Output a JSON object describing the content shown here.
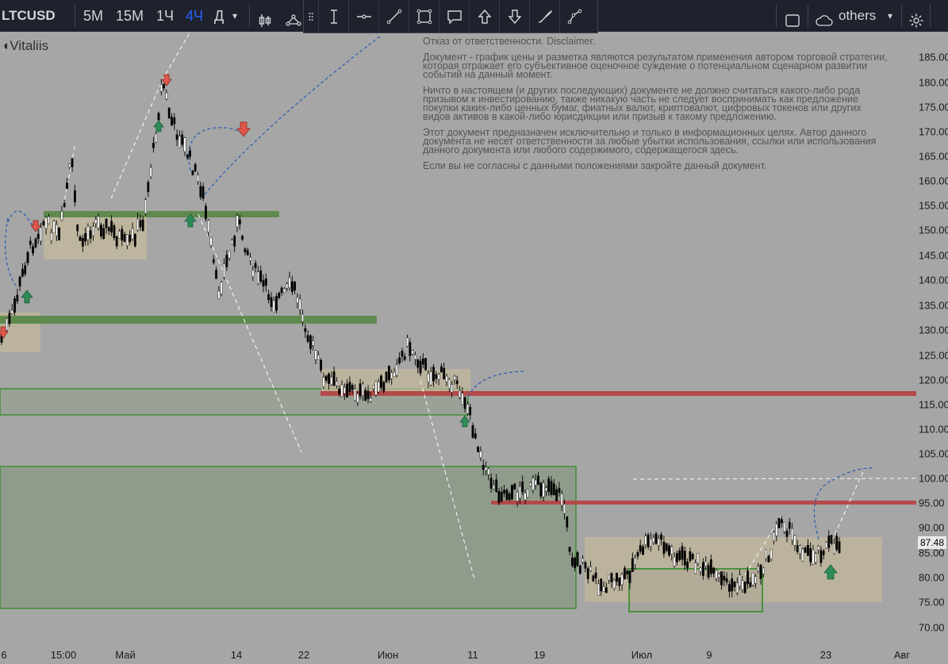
{
  "toolbar": {
    "symbol": "LTCUSD",
    "intervals": [
      "5М",
      "15М",
      "1Ч",
      "4Ч",
      "Д"
    ],
    "active_interval": "4Ч",
    "layout_name": "others"
  },
  "watermark": {
    "author": "Vitaliis"
  },
  "disclaimer": {
    "p1": "Отказ от ответственности. Disclaimer.",
    "p2": "Документ - график цены и разметка являются результатом применения автором торговой стратегии, которая отражает его субъективное оценочное суждение о потенциальном сценарном развитии событий на данный момент.",
    "p3": "Ничто в настоящем (и других последующих) документе не должно считаться какого-либо рода призывом к инвестированию, также никакую часть не следует воспринимать как предложение покупки каких-либо ценных бумаг, фиатных валют, криптовалют, цифровых токенов или других видов активов в какой-либо юрисдикции или призыв к такому предложению.",
    "p4": "Этот документ предназначен исключительно и только в информационных целях. Автор данного документа не несет ответственности за любые убытки использования, ссылки или использования данного документа или любого содержимого, содержащегося здесь.",
    "p5": "Если вы не согласны с данными положениями закройте данный документ."
  },
  "price_axis": {
    "labels": [
      "185.00",
      "180.00",
      "175.00",
      "170.00",
      "165.00",
      "160.00",
      "155.00",
      "150.00",
      "145.00",
      "140.00",
      "135.00",
      "130.00",
      "125.00",
      "120.00",
      "115.00",
      "110.00",
      "105.00",
      "100.00",
      "95.00",
      "90.00",
      "85.00",
      "80.00",
      "75.00",
      "70.00"
    ],
    "current_price": "87.48"
  },
  "time_axis": {
    "labels": [
      "6",
      "15:00",
      "Май",
      "14",
      "22",
      "Июн",
      "11",
      "19",
      "Июл",
      "9",
      "23",
      "Авг"
    ]
  },
  "colors": {
    "background": "#a6a6a6",
    "support_green": "#5f8a4e",
    "resistance_red": "#b54a4a",
    "zone_tan": "#c4b99a",
    "box_green": "#3f8f33",
    "arrow_up": "#2e8b57",
    "arrow_down": "#e0564a",
    "projection_blue": "#2a5db0"
  }
}
